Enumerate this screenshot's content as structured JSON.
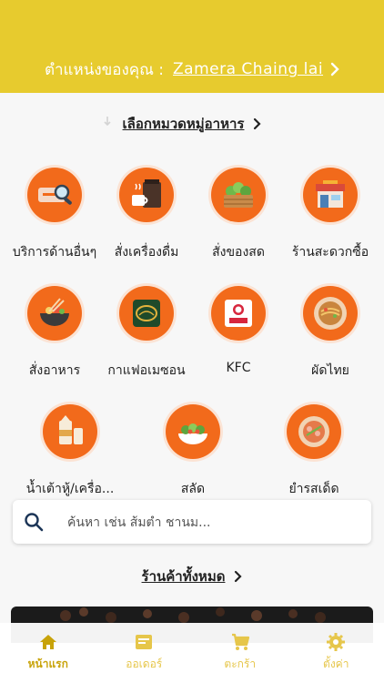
{
  "colors": {
    "brand_yellow": "#e7cb2e",
    "category_orange": "#f26a1b",
    "tab_inactive": "#e6c64a",
    "tab_active": "#c8a30a"
  },
  "header": {
    "location_label": "ตำแหน่งของคุณ :",
    "location_value": "Zamera Chaing lai"
  },
  "categories_section": {
    "title": "เลือกหมวดหมู่อาหาร"
  },
  "categories": [
    {
      "label": "บริการด้านอื่นๆ",
      "icon": "search-service-icon"
    },
    {
      "label": "สั่งเครื่องดื่ม",
      "icon": "drinks-icon"
    },
    {
      "label": "สั่งของสด",
      "icon": "fresh-produce-icon"
    },
    {
      "label": "ร้านสะดวกซื้อ",
      "icon": "convenience-store-icon"
    },
    {
      "label": "สั่งอาหาร",
      "icon": "food-bowl-icon"
    },
    {
      "label": "กาแฟอเมซอน",
      "icon": "amazon-coffee-icon"
    },
    {
      "label": "KFC",
      "icon": "kfc-icon"
    },
    {
      "label": "ผัดไทย",
      "icon": "padthai-icon"
    },
    {
      "label": "น้ำเต้าหู้/เครื่อ...",
      "icon": "soy-milk-icon"
    },
    {
      "label": "สลัด",
      "icon": "salad-icon"
    },
    {
      "label": "ยำรสเด็ด",
      "icon": "spicy-salad-icon"
    }
  ],
  "search": {
    "placeholder": "ค้นหา เช่น ส้มตำ ชานม..."
  },
  "stores_section": {
    "title": "ร้านค้าทั้งหมด"
  },
  "tabbar": {
    "items": [
      {
        "label": "หน้าแรก",
        "icon": "home-icon",
        "active": true
      },
      {
        "label": "ออเดอร์",
        "icon": "orders-icon",
        "active": false
      },
      {
        "label": "ตะกร้า",
        "icon": "cart-icon",
        "active": false
      },
      {
        "label": "ตั้งค่า",
        "icon": "gear-icon",
        "active": false
      }
    ]
  }
}
